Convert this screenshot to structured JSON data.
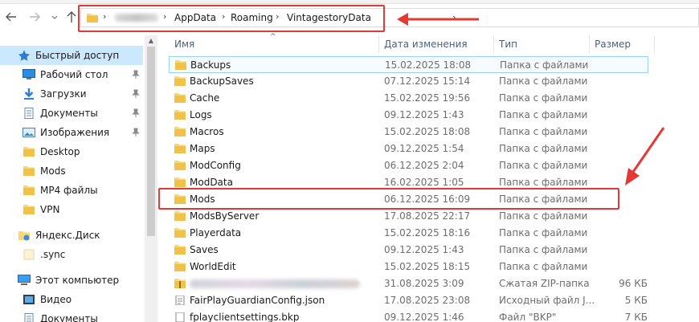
{
  "address": {
    "crumbs": [
      "AppData",
      "Roaming",
      "VintagestoryData"
    ],
    "separator": "›"
  },
  "columns": {
    "name": "Имя",
    "date": "Дата изменения",
    "type": "Тип",
    "size": "Размер"
  },
  "sidebar": {
    "items": [
      {
        "label": "Быстрый доступ",
        "icon": "star-icon"
      },
      {
        "label": "Рабочий стол",
        "icon": "desktop-icon",
        "pinned": true
      },
      {
        "label": "Загрузки",
        "icon": "download-icon",
        "pinned": true
      },
      {
        "label": "Документы",
        "icon": "document-icon",
        "pinned": true
      },
      {
        "label": "Изображения",
        "icon": "image-icon",
        "pinned": true
      },
      {
        "label": "Desktop",
        "icon": "folder-icon"
      },
      {
        "label": "Mods",
        "icon": "folder-icon"
      },
      {
        "label": "MP4 файлы",
        "icon": "folder-icon"
      },
      {
        "label": "VPN",
        "icon": "folder-icon"
      },
      {
        "label": "Яндекс.Диск",
        "icon": "cloud-drive-icon"
      },
      {
        "label": ".sync",
        "icon": "file-icon"
      },
      {
        "label": "Этот компьютер",
        "icon": "computer-icon"
      },
      {
        "label": "Видео",
        "icon": "video-icon"
      },
      {
        "label": "Документы",
        "icon": "document-icon"
      }
    ]
  },
  "files": [
    {
      "name": "Backups",
      "date": "15.02.2025 18:08",
      "type": "Папка с файлами",
      "size": ""
    },
    {
      "name": "BackupSaves",
      "date": "07.12.2025 15:14",
      "type": "Папка с файлами",
      "size": ""
    },
    {
      "name": "Cache",
      "date": "15.02.2025 19:56",
      "type": "Папка с файлами",
      "size": ""
    },
    {
      "name": "Logs",
      "date": "09.12.2025 1:43",
      "type": "Папка с файлами",
      "size": ""
    },
    {
      "name": "Macros",
      "date": "15.02.2025 18:08",
      "type": "Папка с файлами",
      "size": ""
    },
    {
      "name": "Maps",
      "date": "09.12.2025 1:54",
      "type": "Папка с файлами",
      "size": ""
    },
    {
      "name": "ModConfig",
      "date": "06.12.2025 2:04",
      "type": "Папка с файлами",
      "size": ""
    },
    {
      "name": "ModData",
      "date": "16.02.2025 1:05",
      "type": "Папка с файлами",
      "size": ""
    },
    {
      "name": "Mods",
      "date": "06.12.2025 16:09",
      "type": "Папка с файлами",
      "size": ""
    },
    {
      "name": "ModsByServer",
      "date": "17.08.2025 22:17",
      "type": "Папка с файлами",
      "size": ""
    },
    {
      "name": "Playerdata",
      "date": "15.02.2025 18:16",
      "type": "Папка с файлами",
      "size": ""
    },
    {
      "name": "Saves",
      "date": "09.12.2025 1:43",
      "type": "Папка с файлами",
      "size": ""
    },
    {
      "name": "WorldEdit",
      "date": "15.02.2025 18:15",
      "type": "Папка с файлами",
      "size": ""
    },
    {
      "name": "",
      "date": "31.08.2025 3:09",
      "type": "Сжатая ZIP-папка",
      "size": "96 КБ"
    },
    {
      "name": "FairPlayGuardianConfig.json",
      "date": "17.08.2025 23:08",
      "type": "Исходный файл J...",
      "size": "5 КБ"
    },
    {
      "name": "fplayclientsettings.bkp",
      "date": "09.12.2025 1:46",
      "type": "Файл \"BKP\"",
      "size": "7 КБ"
    }
  ],
  "colors": {
    "selection": "#cce8ff",
    "hover_border": "#99d1ff",
    "annotation": "#e53935",
    "folder": "#f8d775"
  }
}
